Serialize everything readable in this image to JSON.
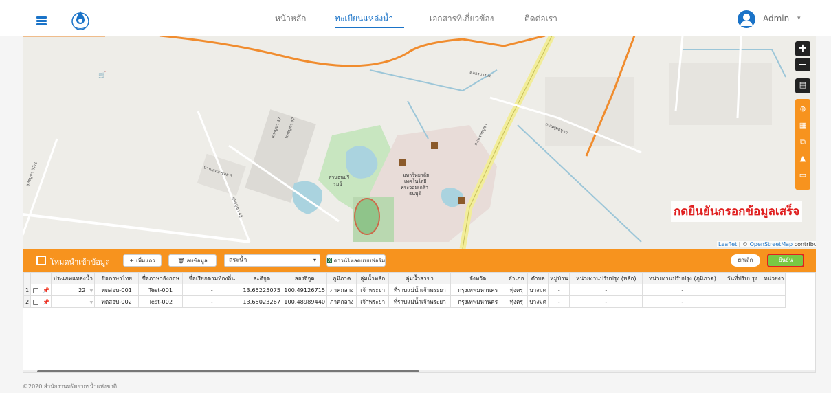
{
  "navbar": {
    "links": [
      "หน้าหลัก",
      "ทะเบียนแหล่งน้ำ",
      "เอกสารที่เกี่ยวข้อง",
      "ติดต่อเรา"
    ],
    "active": "ทะเบียนแหล่งน้ำ",
    "user": "Admin"
  },
  "map": {
    "zoom_in": "+",
    "zoom_out": "−",
    "hint": "กดยืนยันกรอกข้อมูลเสร็จ",
    "attribution_leaflet": "Leaflet",
    "attribution_sep": " | © ",
    "attribution_osm": "OpenStreetMap",
    "attribution_tail": " contributors",
    "labels": {
      "park": "สวนธนบุรี\nรมย์",
      "university": "มหาวิทยาลัย\nเทคโนโลยี\nพระจอมเกล้า\nธนบุรี",
      "soi3": "บ้านเสมอ ซอย 3",
      "soi47a": "พุทธบูชา 47",
      "soi47b": "พุทธบูชา 47",
      "soi42": "พุทธบูชา 42",
      "road_right": "ถนนพุทธบูชา",
      "road_top": "คลองบางมด",
      "road_right2": "ถนนพุทธบูชา",
      "road_left": "พุทธบูชา 37/1"
    }
  },
  "toolbar": {
    "title": "โหมดนำเข้าข้อมูล",
    "add_row": "เพิ่มแถว",
    "delete": "ลบข้อมูล",
    "type_select": "สระน้ำ",
    "download": "ดาวน์โหลดแบบฟอร์ม",
    "cancel": "ยกเลิก",
    "confirm": "ยืนยัน"
  },
  "table": {
    "headers": [
      "ประเภทแหล่งน้ำ",
      "ชื่อภาษาไทย",
      "ชื่อภาษาอังกฤษ",
      "ชื่อเรียกตามท้องถิ่น",
      "ละติจูด",
      "ลองจิจูด",
      "ภูมิภาค",
      "ลุ่มน้ำหลัก",
      "ลุ่มน้ำสาขา",
      "จังหวัด",
      "อำเภอ",
      "ตำบล",
      "หมู่บ้าน",
      "หน่วยงานปรับปรุง (หลัก)",
      "หน่วยงานปรับปรุง (ภูมิภาค)",
      "วันที่ปรับปรุง",
      "หน่วยงา"
    ],
    "rows": [
      {
        "num": "1",
        "type": "22",
        "thai": "ทดสอบ-001",
        "eng": "Test-001",
        "local": "-",
        "lat": "13.65225075",
        "lon": "100.49126715",
        "region": "ภาคกลาง",
        "basin": "เจ้าพระยา",
        "sub": "ที่ราบแม่น้ำเจ้าพระยา",
        "province": "กรุงเทพมหานคร",
        "district": "ทุ่งครุ",
        "subdistrict": "บางมด",
        "village": "-",
        "main_agency": "-",
        "reg_agency": "-",
        "date": "",
        "more": ""
      },
      {
        "num": "2",
        "type": "",
        "thai": "ทดสอบ-002",
        "eng": "Test-002",
        "local": "-",
        "lat": "13.65023267",
        "lon": "100.48989440",
        "region": "ภาคกลาง",
        "basin": "เจ้าพระยา",
        "sub": "ที่ราบแม่น้ำเจ้าพระยา",
        "province": "กรุงเทพมหานคร",
        "district": "ทุ่งครุ",
        "subdistrict": "บางมด",
        "village": "-",
        "main_agency": "-",
        "reg_agency": "-",
        "date": "",
        "more": ""
      }
    ]
  },
  "footer": "©2020 สำนักงานทรัพยากรน้ำแห่งชาติ",
  "colors": {
    "primary": "#1a73c8",
    "toolbar": "#f7931e",
    "confirm": "#7ac943",
    "highlight": "#e02020"
  }
}
